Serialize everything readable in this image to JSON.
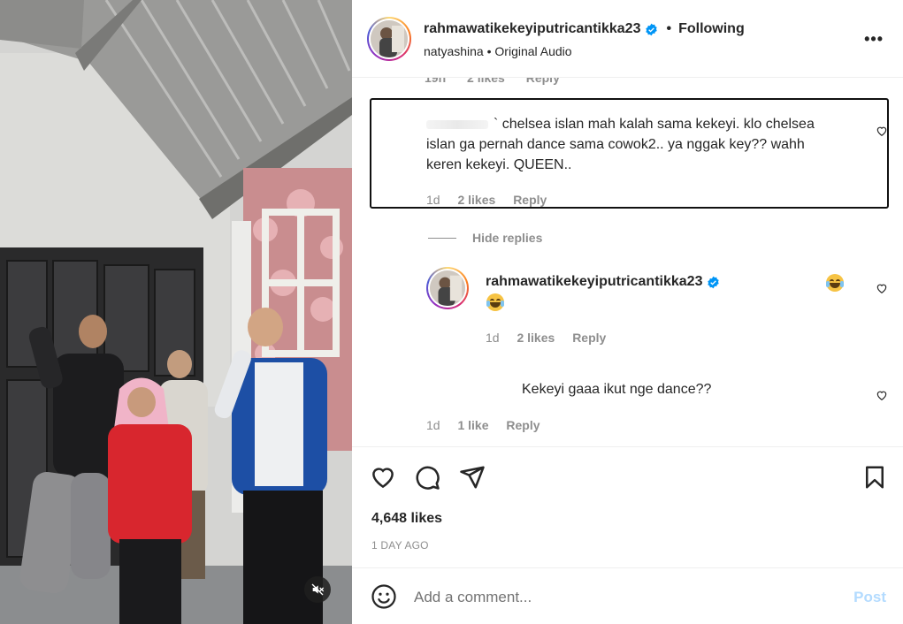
{
  "post": {
    "username": "rahmawatikekeyiputricantikka23",
    "dot": "•",
    "follow_state": "Following",
    "audio_author": "natyashina",
    "audio_sep": "•",
    "audio_label": "Original Audio",
    "more": "•••"
  },
  "comments": {
    "partial_meta": {
      "time": "19h",
      "likes": "2 likes",
      "reply": "Reply"
    },
    "highlighted": {
      "text_line1": "` chelsea islan mah kalah sama kekeyi. klo chelsea",
      "text_line2": "islan ga pernah dance sama cowok2.. ya nggak key?? wahh",
      "text_line3": "keren kekeyi. QUEEN..",
      "time": "1d",
      "likes": "2 likes",
      "reply": "Reply"
    },
    "hide_replies": "Hide replies",
    "reply_1": {
      "username": "rahmawatikekeyiputricantikka23",
      "time": "1d",
      "likes": "2 likes",
      "reply": "Reply"
    },
    "reply_2": {
      "text": "Kekeyi gaaa ikut nge dance??",
      "time": "1d",
      "likes": "1 like",
      "reply": "Reply"
    }
  },
  "actions": {
    "likes_count": "4,648 likes",
    "time_ago": "1 DAY AGO"
  },
  "comment_box": {
    "placeholder": "Add a comment...",
    "post_label": "Post"
  },
  "colors": {
    "verified": "#0095f6",
    "post_disabled": "#b3dbff",
    "muted_text": "#8e8e8e"
  }
}
